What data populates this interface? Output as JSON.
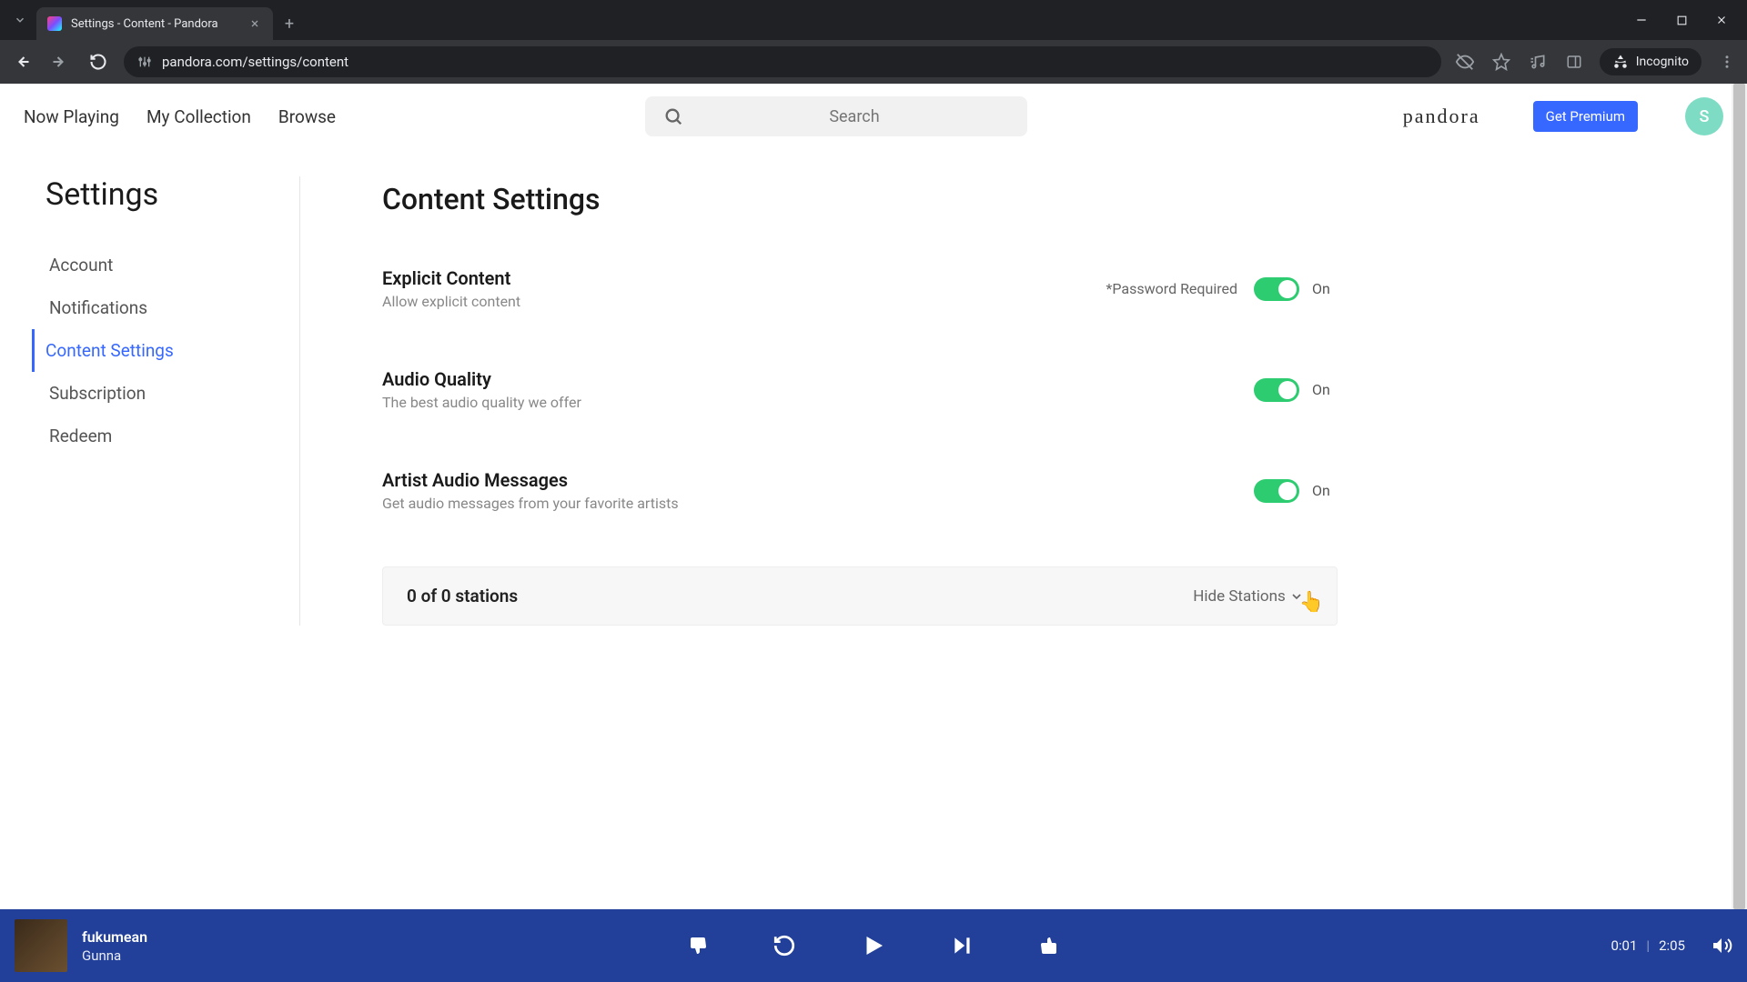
{
  "browser": {
    "tab_title": "Settings - Content - Pandora",
    "url": "pandora.com/settings/content",
    "incognito_label": "Incognito"
  },
  "nav": {
    "now_playing": "Now Playing",
    "my_collection": "My Collection",
    "browse": "Browse",
    "search_placeholder": "Search",
    "brand": "pandora",
    "premium_label": "Get Premium",
    "avatar_initial": "S"
  },
  "sidebar": {
    "title": "Settings",
    "items": [
      {
        "label": "Account"
      },
      {
        "label": "Notifications"
      },
      {
        "label": "Content Settings"
      },
      {
        "label": "Subscription"
      },
      {
        "label": "Redeem"
      }
    ]
  },
  "main": {
    "heading": "Content Settings",
    "settings": [
      {
        "title": "Explicit Content",
        "desc": "Allow explicit content",
        "note": "*Password Required",
        "state_label": "On"
      },
      {
        "title": "Audio Quality",
        "desc": "The best audio quality we offer",
        "note": "",
        "state_label": "On"
      },
      {
        "title": "Artist Audio Messages",
        "desc": "Get audio messages from your favorite artists",
        "note": "",
        "state_label": "On"
      }
    ],
    "stations_count": "0 of 0 stations",
    "hide_stations": "Hide Stations"
  },
  "player": {
    "track_title": "fukumean",
    "track_artist": "Gunna",
    "elapsed": "0:01",
    "duration": "2:05"
  }
}
